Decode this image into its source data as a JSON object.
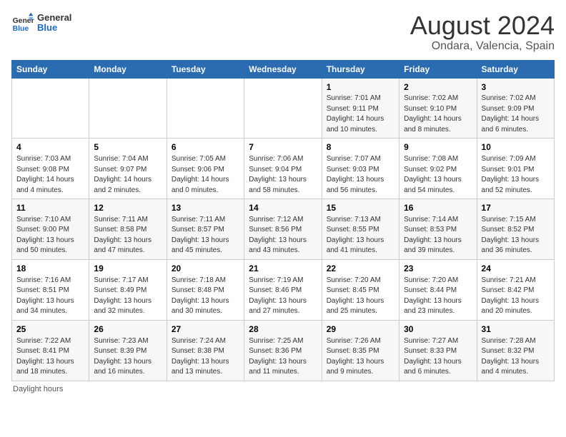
{
  "header": {
    "logo_general": "General",
    "logo_blue": "Blue",
    "title": "August 2024",
    "subtitle": "Ondara, Valencia, Spain"
  },
  "days_of_week": [
    "Sunday",
    "Monday",
    "Tuesday",
    "Wednesday",
    "Thursday",
    "Friday",
    "Saturday"
  ],
  "weeks": [
    [
      {
        "day": "",
        "info": ""
      },
      {
        "day": "",
        "info": ""
      },
      {
        "day": "",
        "info": ""
      },
      {
        "day": "",
        "info": ""
      },
      {
        "day": "1",
        "info": "Sunrise: 7:01 AM\nSunset: 9:11 PM\nDaylight: 14 hours\nand 10 minutes."
      },
      {
        "day": "2",
        "info": "Sunrise: 7:02 AM\nSunset: 9:10 PM\nDaylight: 14 hours\nand 8 minutes."
      },
      {
        "day": "3",
        "info": "Sunrise: 7:02 AM\nSunset: 9:09 PM\nDaylight: 14 hours\nand 6 minutes."
      }
    ],
    [
      {
        "day": "4",
        "info": "Sunrise: 7:03 AM\nSunset: 9:08 PM\nDaylight: 14 hours\nand 4 minutes."
      },
      {
        "day": "5",
        "info": "Sunrise: 7:04 AM\nSunset: 9:07 PM\nDaylight: 14 hours\nand 2 minutes."
      },
      {
        "day": "6",
        "info": "Sunrise: 7:05 AM\nSunset: 9:06 PM\nDaylight: 14 hours\nand 0 minutes."
      },
      {
        "day": "7",
        "info": "Sunrise: 7:06 AM\nSunset: 9:04 PM\nDaylight: 13 hours\nand 58 minutes."
      },
      {
        "day": "8",
        "info": "Sunrise: 7:07 AM\nSunset: 9:03 PM\nDaylight: 13 hours\nand 56 minutes."
      },
      {
        "day": "9",
        "info": "Sunrise: 7:08 AM\nSunset: 9:02 PM\nDaylight: 13 hours\nand 54 minutes."
      },
      {
        "day": "10",
        "info": "Sunrise: 7:09 AM\nSunset: 9:01 PM\nDaylight: 13 hours\nand 52 minutes."
      }
    ],
    [
      {
        "day": "11",
        "info": "Sunrise: 7:10 AM\nSunset: 9:00 PM\nDaylight: 13 hours\nand 50 minutes."
      },
      {
        "day": "12",
        "info": "Sunrise: 7:11 AM\nSunset: 8:58 PM\nDaylight: 13 hours\nand 47 minutes."
      },
      {
        "day": "13",
        "info": "Sunrise: 7:11 AM\nSunset: 8:57 PM\nDaylight: 13 hours\nand 45 minutes."
      },
      {
        "day": "14",
        "info": "Sunrise: 7:12 AM\nSunset: 8:56 PM\nDaylight: 13 hours\nand 43 minutes."
      },
      {
        "day": "15",
        "info": "Sunrise: 7:13 AM\nSunset: 8:55 PM\nDaylight: 13 hours\nand 41 minutes."
      },
      {
        "day": "16",
        "info": "Sunrise: 7:14 AM\nSunset: 8:53 PM\nDaylight: 13 hours\nand 39 minutes."
      },
      {
        "day": "17",
        "info": "Sunrise: 7:15 AM\nSunset: 8:52 PM\nDaylight: 13 hours\nand 36 minutes."
      }
    ],
    [
      {
        "day": "18",
        "info": "Sunrise: 7:16 AM\nSunset: 8:51 PM\nDaylight: 13 hours\nand 34 minutes."
      },
      {
        "day": "19",
        "info": "Sunrise: 7:17 AM\nSunset: 8:49 PM\nDaylight: 13 hours\nand 32 minutes."
      },
      {
        "day": "20",
        "info": "Sunrise: 7:18 AM\nSunset: 8:48 PM\nDaylight: 13 hours\nand 30 minutes."
      },
      {
        "day": "21",
        "info": "Sunrise: 7:19 AM\nSunset: 8:46 PM\nDaylight: 13 hours\nand 27 minutes."
      },
      {
        "day": "22",
        "info": "Sunrise: 7:20 AM\nSunset: 8:45 PM\nDaylight: 13 hours\nand 25 minutes."
      },
      {
        "day": "23",
        "info": "Sunrise: 7:20 AM\nSunset: 8:44 PM\nDaylight: 13 hours\nand 23 minutes."
      },
      {
        "day": "24",
        "info": "Sunrise: 7:21 AM\nSunset: 8:42 PM\nDaylight: 13 hours\nand 20 minutes."
      }
    ],
    [
      {
        "day": "25",
        "info": "Sunrise: 7:22 AM\nSunset: 8:41 PM\nDaylight: 13 hours\nand 18 minutes."
      },
      {
        "day": "26",
        "info": "Sunrise: 7:23 AM\nSunset: 8:39 PM\nDaylight: 13 hours\nand 16 minutes."
      },
      {
        "day": "27",
        "info": "Sunrise: 7:24 AM\nSunset: 8:38 PM\nDaylight: 13 hours\nand 13 minutes."
      },
      {
        "day": "28",
        "info": "Sunrise: 7:25 AM\nSunset: 8:36 PM\nDaylight: 13 hours\nand 11 minutes."
      },
      {
        "day": "29",
        "info": "Sunrise: 7:26 AM\nSunset: 8:35 PM\nDaylight: 13 hours\nand 9 minutes."
      },
      {
        "day": "30",
        "info": "Sunrise: 7:27 AM\nSunset: 8:33 PM\nDaylight: 13 hours\nand 6 minutes."
      },
      {
        "day": "31",
        "info": "Sunrise: 7:28 AM\nSunset: 8:32 PM\nDaylight: 13 hours\nand 4 minutes."
      }
    ]
  ],
  "footer": {
    "daylight_note": "Daylight hours"
  }
}
